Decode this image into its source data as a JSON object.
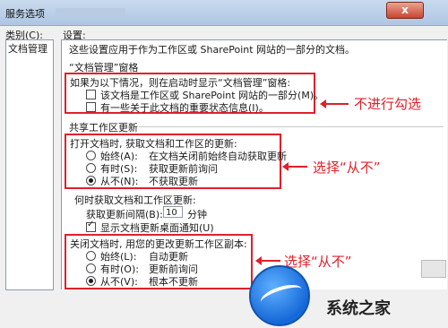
{
  "window": {
    "title": "服务选项",
    "close": "x"
  },
  "labels": {
    "category": "类别(C):",
    "settings": "设置:"
  },
  "categories": [
    "文档管理"
  ],
  "intro": "这些设置应用于作为工作区或 SharePoint 网站的一部分的文档。",
  "section1": {
    "title": "“文档管理”窗格",
    "desc": "如果为以下情况，则在启动时显示“文档管理”窗格:",
    "options": [
      {
        "label": "该文档是工作区或 SharePoint 网站的一部分(M)。",
        "checked": false
      },
      {
        "label": "有一些关于此文档的重要状态信息(I)。",
        "checked": false
      }
    ]
  },
  "section2": {
    "title": "共享工作区更新",
    "open_title": "打开文档时, 获取文档和工作区的更新:",
    "open_options": [
      {
        "label": "始终(A):",
        "desc": "在文档关闭前始终自动获取更新",
        "selected": false
      },
      {
        "label": "有时(S):",
        "desc": "获取更新前询问",
        "selected": false
      },
      {
        "label": "从不(N):",
        "desc": "不获取更新",
        "selected": true
      }
    ],
    "when_title": "何时获取文档和工作区更新:",
    "interval_label": "获取更新间隔(B):",
    "interval_value": "10",
    "interval_unit": "分钟",
    "notify_label": "显示文档更新桌面通知(U)",
    "notify_checked": true,
    "close_title": "关闭文档时, 用您的更改更新工作区副本:",
    "close_options": [
      {
        "label": "始终(L):",
        "desc": "自动更新",
        "selected": false
      },
      {
        "label": "有时(O):",
        "desc": "更新前询问",
        "selected": false
      },
      {
        "label": "从不(V):",
        "desc": "根本不更新",
        "selected": true
      }
    ]
  },
  "annotations": [
    "不进行勾选",
    "选择“从不”",
    "选择“从不”"
  ],
  "watermark": "系统之家",
  "colors": {
    "highlight": "#e0202a",
    "titlebar": "#aec6e3"
  }
}
